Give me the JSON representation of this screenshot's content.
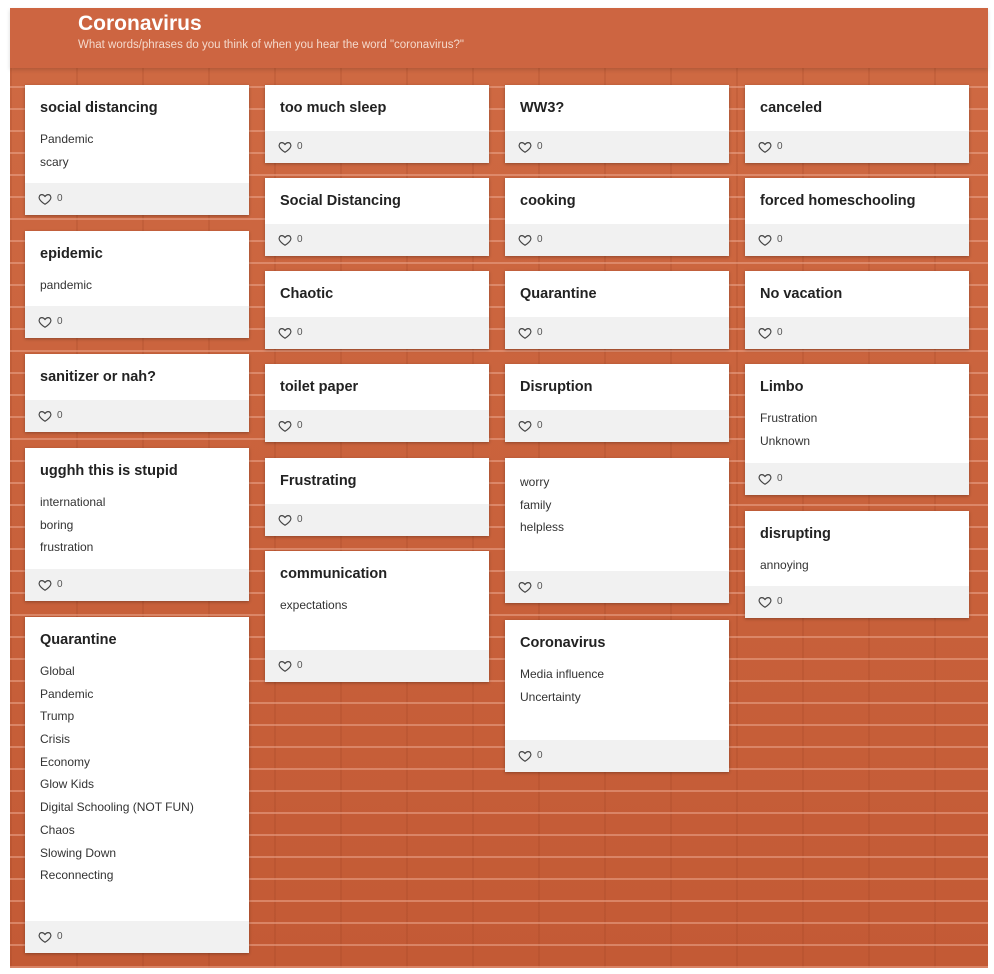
{
  "header": {
    "title": "Coronavirus",
    "subtitle": "What words/phrases do you think of when you hear the word \"coronavirus?\""
  },
  "columns": [
    [
      {
        "title": "social distancing",
        "lines": [
          "Pandemic",
          "scary"
        ],
        "likes": "0"
      },
      {
        "title": "epidemic",
        "lines": [
          "pandemic"
        ],
        "likes": "0"
      },
      {
        "title": "sanitizer or nah?",
        "lines": [],
        "likes": "0"
      },
      {
        "title": "ugghh this is stupid",
        "lines": [
          "international",
          "boring",
          "frustration"
        ],
        "likes": "0"
      },
      {
        "title": "Quarantine",
        "lines": [
          "Global",
          "Pandemic",
          "Trump",
          "Crisis",
          "Economy",
          "Glow Kids",
          "Digital Schooling (NOT FUN)",
          "Chaos",
          "Slowing Down",
          "Reconnecting"
        ],
        "likes": "0"
      }
    ],
    [
      {
        "title": "too much sleep",
        "lines": [],
        "likes": "0"
      },
      {
        "title": "Social Distancing",
        "lines": [],
        "likes": "0"
      },
      {
        "title": "Chaotic",
        "lines": [],
        "likes": "0"
      },
      {
        "title": "toilet paper",
        "lines": [],
        "likes": "0"
      },
      {
        "title": "Frustrating",
        "lines": [],
        "likes": "0"
      },
      {
        "title": "communication",
        "lines": [
          "expectations"
        ],
        "likes": "0"
      }
    ],
    [
      {
        "title": "WW3?",
        "lines": [],
        "likes": "0"
      },
      {
        "title": "cooking",
        "lines": [],
        "likes": "0"
      },
      {
        "title": "Quarantine",
        "lines": [],
        "likes": "0"
      },
      {
        "title": "Disruption",
        "lines": [],
        "likes": "0"
      },
      {
        "title": "",
        "lines": [
          "worry",
          "family",
          "helpless"
        ],
        "likes": "0"
      },
      {
        "title": "Coronavirus",
        "lines": [
          "Media influence",
          "Uncertainty"
        ],
        "likes": "0"
      }
    ],
    [
      {
        "title": "canceled",
        "lines": [],
        "likes": "0"
      },
      {
        "title": "forced homeschooling",
        "lines": [],
        "likes": "0"
      },
      {
        "title": "No vacation",
        "lines": [],
        "likes": "0"
      },
      {
        "title": "Limbo",
        "lines": [
          "Frustration",
          "Unknown"
        ],
        "likes": "0"
      },
      {
        "title": "disrupting",
        "lines": [
          "annoying"
        ],
        "likes": "0"
      }
    ]
  ],
  "icons": {
    "like": "heart-icon"
  },
  "colors": {
    "wall": "#c8603a",
    "header": "#cd6541",
    "card": "#ffffff",
    "card_footer": "#f1f1f1"
  }
}
